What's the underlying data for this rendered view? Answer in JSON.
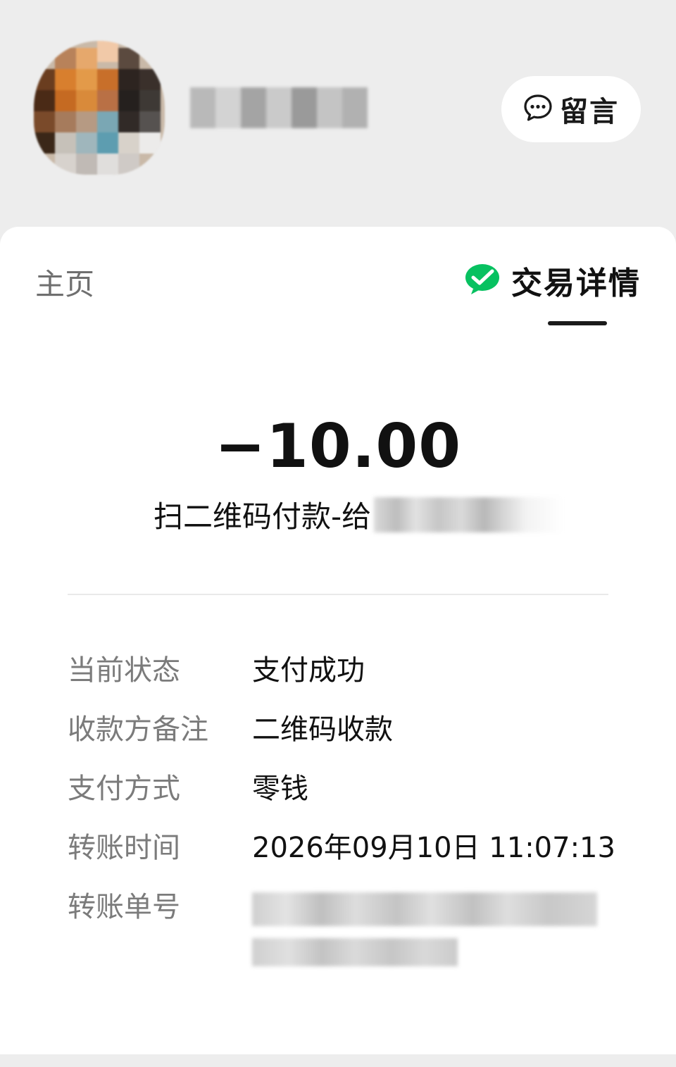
{
  "header": {
    "message_button_label": "留言"
  },
  "tabs": {
    "home_label": "主页",
    "detail_label": "交易详情"
  },
  "transaction": {
    "amount": "−10.00",
    "description": "扫二维码付款-给"
  },
  "details": [
    {
      "key": "当前状态",
      "value": "支付成功"
    },
    {
      "key": "收款方备注",
      "value": "二维码收款"
    },
    {
      "key": "支付方式",
      "value": "零钱"
    },
    {
      "key": "转账时间",
      "value": "2026年09月10日 11:07:13"
    },
    {
      "key": "转账单号",
      "value": ""
    }
  ],
  "colors": {
    "background": "#ededed",
    "card": "#ffffff",
    "wechat_green": "#07c160",
    "muted_text": "#7b7b7b"
  },
  "icons": {
    "message": "chat-bubble-icon",
    "brand": "wechat-pay-icon"
  }
}
